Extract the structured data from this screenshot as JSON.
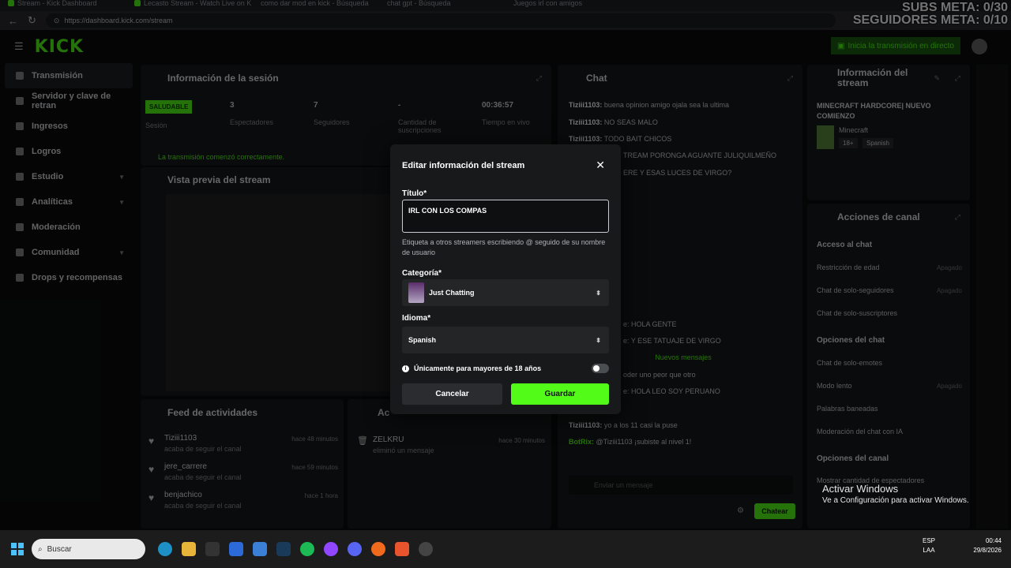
{
  "browser": {
    "tabs": [
      "Stream - Kick Dashboard",
      "Lecasto Stream - Watch Live on K",
      "como dar mod en kick - Búsqueda",
      "chat gpt - Búsqueda",
      "Juegos irl con amigos"
    ],
    "url": "https://dashboard.kick.com/stream"
  },
  "overlay": {
    "line1": "SUBS META: 0/30",
    "line2": "SEGUIDORES META: 0/10"
  },
  "topbar": {
    "logo": "KICK",
    "golive": "Inicia la transmisión en directo"
  },
  "sidebar": {
    "items": [
      {
        "label": "Transmisión"
      },
      {
        "label": "Servidor y clave de retran"
      },
      {
        "label": "Ingresos"
      },
      {
        "label": "Logros"
      },
      {
        "label": "Estudio"
      },
      {
        "label": "Analíticas"
      },
      {
        "label": "Moderación"
      },
      {
        "label": "Comunidad"
      },
      {
        "label": "Drops y recompensas"
      }
    ]
  },
  "session": {
    "title": "Información de la sesión",
    "status": "SALUDABLE",
    "status_label": "Sesión",
    "viewers": "3",
    "viewers_label": "Espectadores",
    "followers": "7",
    "followers_label": "Seguidores",
    "subs": "-",
    "subs_label": "Cantidad de suscripciones",
    "time": "00:36:57",
    "time_label": "Tiempo en vivo",
    "ok_msg": "La transmisión comenzó correctamente."
  },
  "preview": {
    "title": "Vista previa del stream"
  },
  "feed": {
    "title": "Feed de actividades",
    "items": [
      {
        "user": "Tiziii1103",
        "action": "acaba de seguir el canal",
        "time": "hace 48 minutos"
      },
      {
        "user": "jere_carrere",
        "action": "acaba de seguir el canal",
        "time": "hace 59 minutos"
      },
      {
        "user": "benjachico",
        "action": "acaba de seguir el canal",
        "time": "hace 1 hora"
      }
    ]
  },
  "modlog": {
    "title": "Ac",
    "user": "ZELKRU",
    "action": "eliminó un mensaje",
    "time": "hace 30 minutos"
  },
  "chat": {
    "title": "Chat",
    "lines": [
      {
        "user": "Tiziii1103:",
        "msg": "buena opinion amigo ojala sea la ultima"
      },
      {
        "user": "Tiziii1103:",
        "msg": "NO SEAS MALO"
      },
      {
        "user": "Tiziii1103:",
        "msg": "TODO BAIT CHICOS"
      },
      {
        "user": "",
        "msg": "TREAM PORONGA AGUANTE JULIQUILMEÑO"
      },
      {
        "user": "",
        "msg": "ERE Y ESAS LUCES DE VIRGO?"
      },
      {
        "user": "",
        "msg": "e: HOLA GENTE"
      },
      {
        "user": "",
        "msg": "e: Y ESE TATUAJE DE VIRGO"
      },
      {
        "user": "",
        "msg": "oder uno peor que otro"
      },
      {
        "user": "",
        "msg": "e: HOLA LEO SOY PERUANO"
      },
      {
        "user": "Tiziii1103:",
        "msg": "yo a los 11 casi la puse"
      },
      {
        "user": "BotRix:",
        "msg": "@Tiziii1103 ¡subiste al nivel 1!"
      }
    ],
    "new_messages": "Nuevos mensajes",
    "placeholder": "Enviar un mensaje",
    "send": "Chatear"
  },
  "streaminfo": {
    "title": "Información del stream",
    "stream_title": "MINECRAFT HARDCORE| NUEVO COMIENZO",
    "category": "Minecraft",
    "tag1": "18+",
    "tag2": "Spanish"
  },
  "actions": {
    "title": "Acciones de canal",
    "chat_access": "Acceso al chat",
    "age": "Restricción de edad",
    "age_val": "Apagado",
    "followers_only": "Chat de solo-seguidores",
    "followers_val": "Apagado",
    "subs_only": "Chat de solo-suscriptores",
    "chat_options": "Opciones del chat",
    "emotes_only": "Chat de solo-emotes",
    "slow": "Modo lento",
    "slow_val": "Apagado",
    "banned": "Palabras baneadas",
    "ai_mod": "Moderación del chat con IA",
    "channel_options": "Opciones del canal",
    "show_viewers": "Mostrar cantidad de espectadores"
  },
  "modal": {
    "title": "Editar información del stream",
    "title_label": "Título*",
    "title_value": "IRL CON LOS COMPAS",
    "hint": "Etiqueta a otros streamers escribiendo @ seguido de su nombre de usuario",
    "category_label": "Categoría*",
    "category_value": "Just Chatting",
    "language_label": "Idioma*",
    "language_value": "Spanish",
    "adult_label": "Únicamente para mayores de 18 años",
    "cancel": "Cancelar",
    "save": "Guardar"
  },
  "windows": {
    "search": "Buscar",
    "lang1": "ESP",
    "lang2": "LAA",
    "time": "00:44",
    "date": "29/8/2026",
    "activate1": "Activar Windows",
    "activate2": "Ve a Configuración para activar Windows."
  },
  "colors": {
    "accent": "#53fc18",
    "bg": "#0b0c0d",
    "panel": "#18191b"
  }
}
